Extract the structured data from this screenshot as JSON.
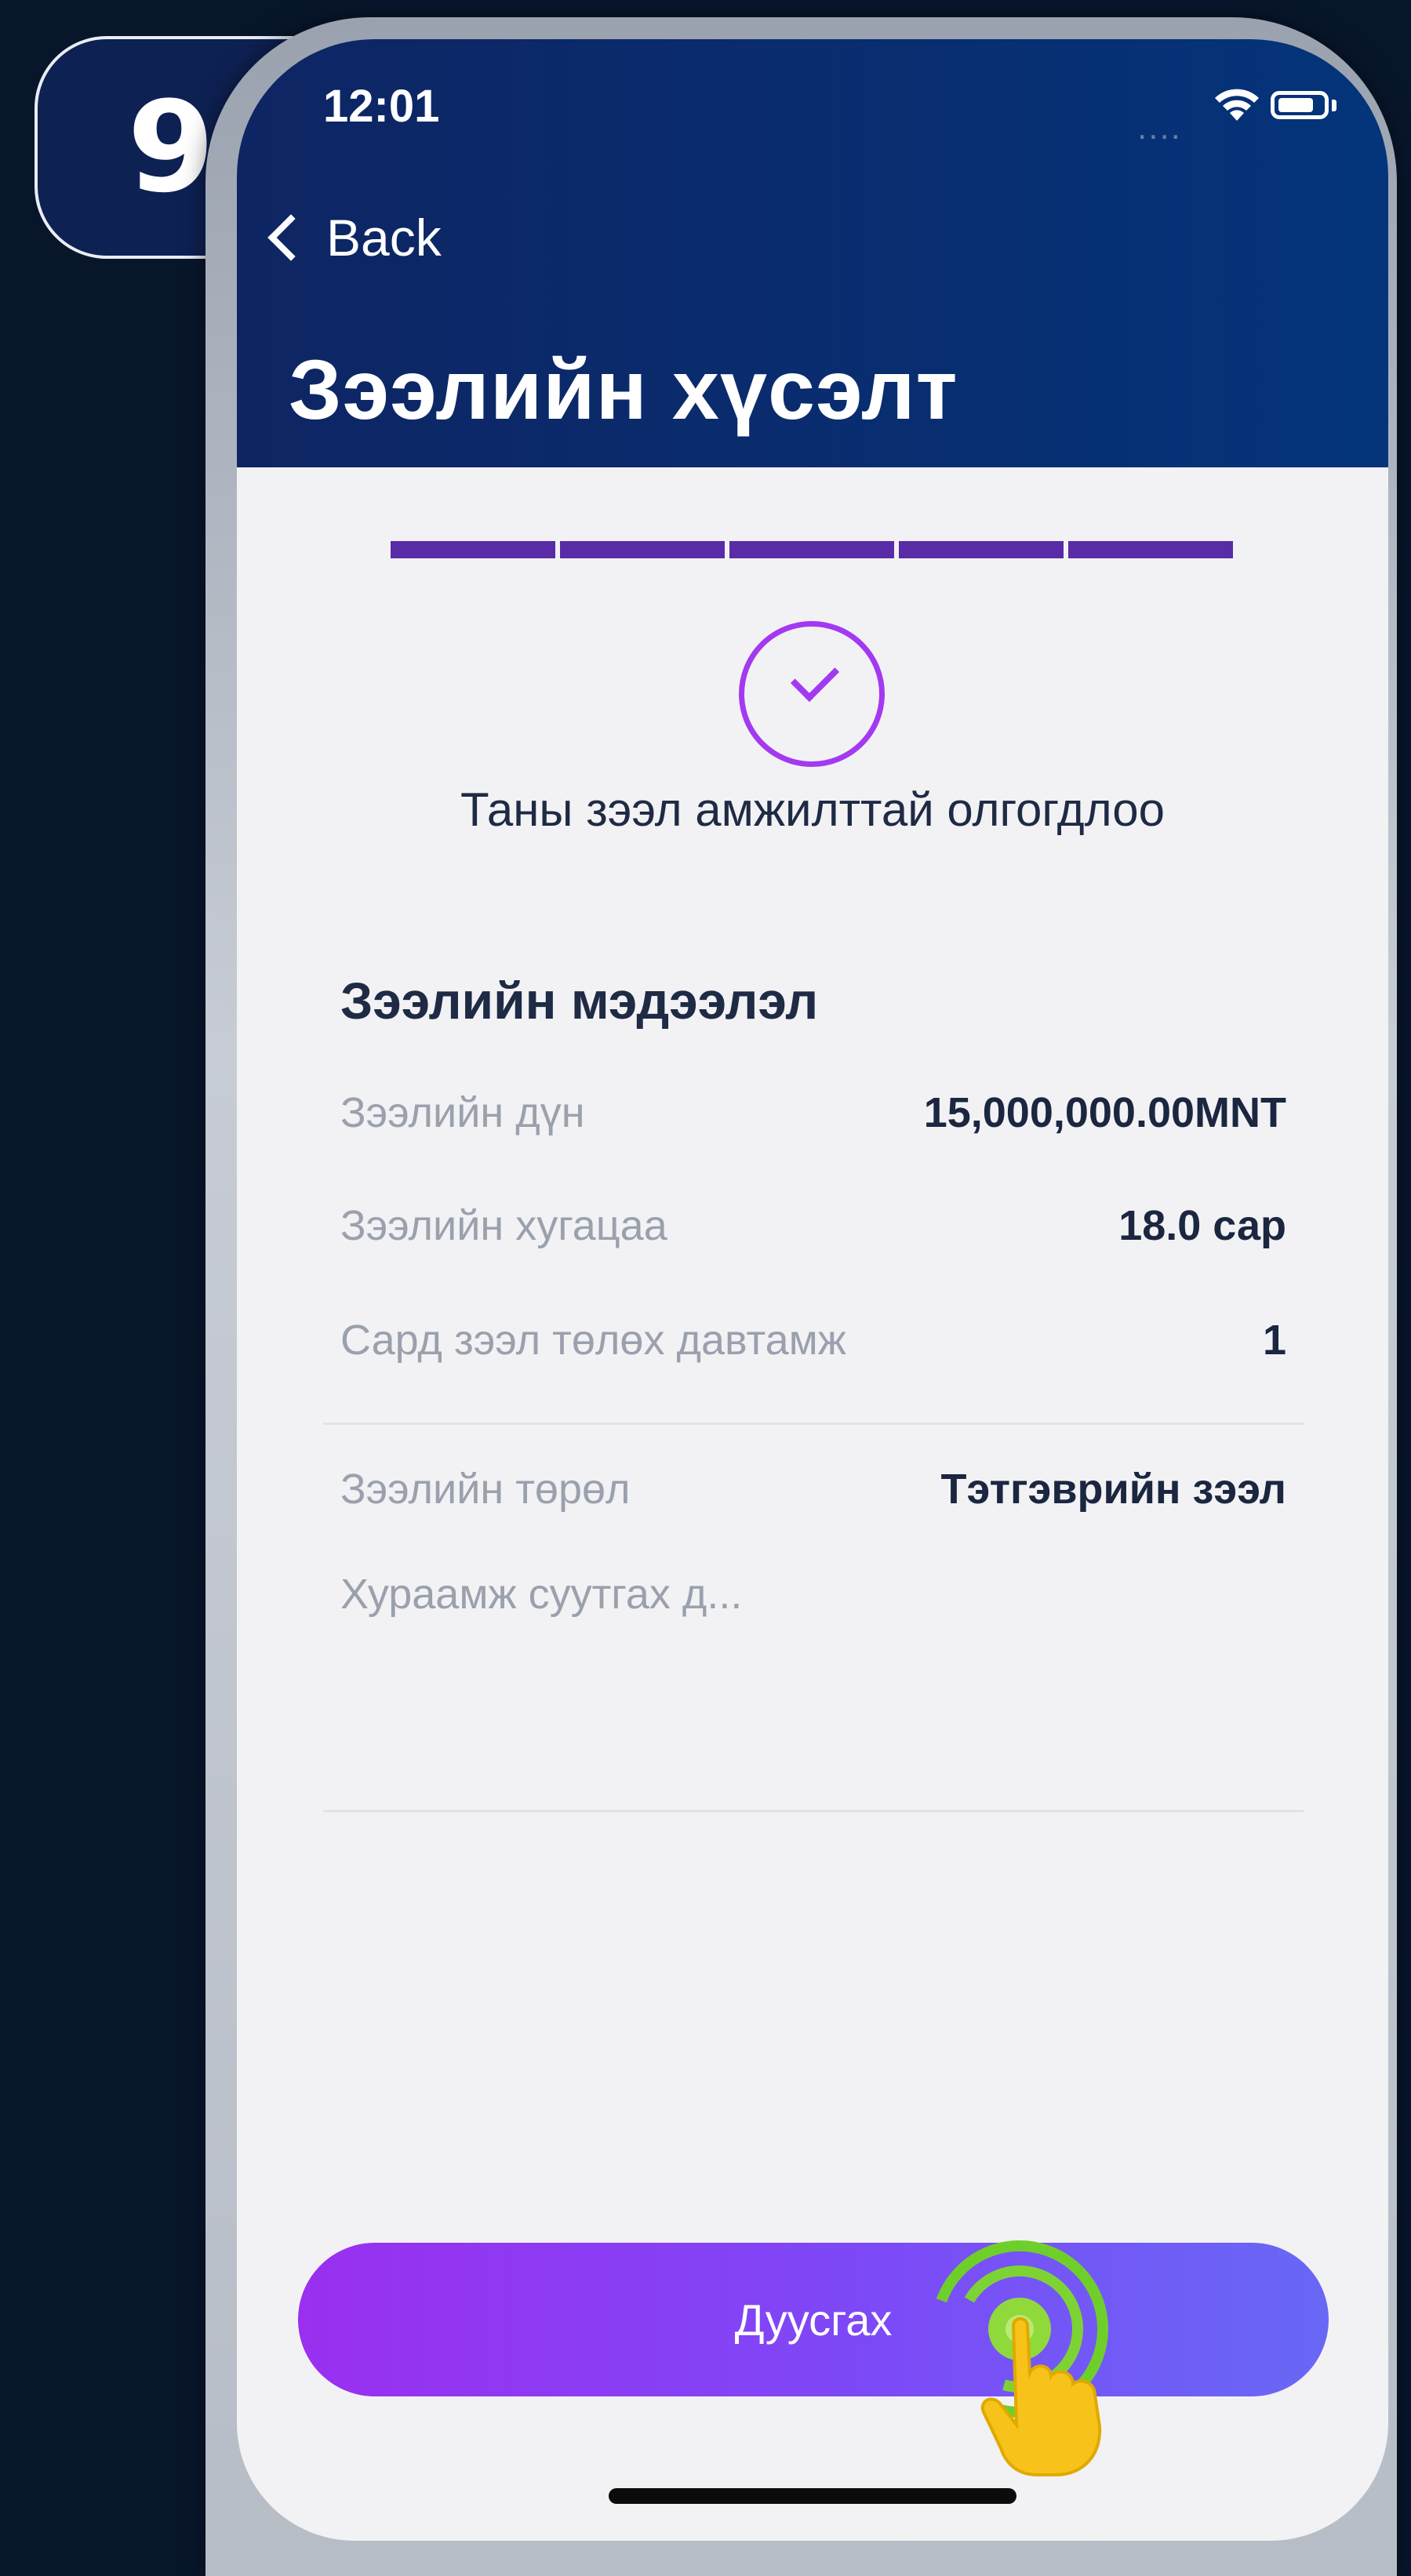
{
  "step": {
    "number": "9"
  },
  "status_bar": {
    "time": "12:01",
    "signal_dots": "....",
    "wifi_icon": "wifi-icon",
    "battery_icon": "battery-icon"
  },
  "nav": {
    "back_label": "Back",
    "back_icon": "chevron-left-icon"
  },
  "header": {
    "title": "Зээлийн хүсэлт"
  },
  "progress": {
    "total_steps": 5,
    "completed_steps": 5,
    "color": "#5a2ba6"
  },
  "result": {
    "icon": "check-circle-icon",
    "message": "Таны зээл амжилттай олгогдлоо",
    "accent_color": "#a339f0"
  },
  "loan_info": {
    "title": "Зээлийн мэдээлэл",
    "rows": [
      {
        "label": "Зээлийн дүн",
        "value": "15,000,000.00MNT"
      },
      {
        "label": "Зээлийн хугацаа",
        "value": "18.0 сар"
      },
      {
        "label": "Сард зээл төлөх давтамж",
        "value": "1"
      }
    ],
    "rows2": [
      {
        "label": "Зээлийн төрөл",
        "value": "Тэтгэврийн зээл"
      },
      {
        "label": "Хураамж суутгах д...",
        "value": ""
      }
    ]
  },
  "actions": {
    "finish_label": "Дуусгах"
  },
  "overlay": {
    "tap_icon": "tap-hand-icon"
  },
  "colors": {
    "header": "#0e2563",
    "button_start": "#9a2ff0",
    "button_end": "#6868f5",
    "background": "#08162c"
  }
}
